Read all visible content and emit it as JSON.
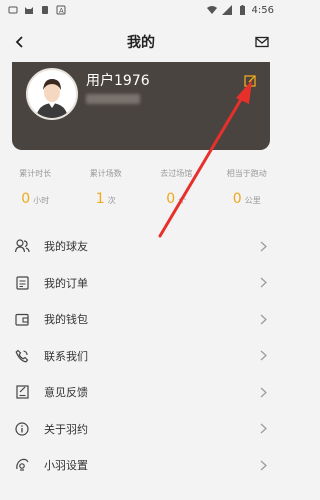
{
  "status_bar": {
    "time": "4:56"
  },
  "nav": {
    "title": "我的"
  },
  "profile": {
    "username": "用户1976"
  },
  "stats": [
    {
      "label": "累计时长",
      "value": "0",
      "unit": "小时"
    },
    {
      "label": "累计场数",
      "value": "1",
      "unit": "次"
    },
    {
      "label": "去过场馆",
      "value": "0",
      "unit": "个"
    },
    {
      "label": "相当于跑动",
      "value": "0",
      "unit": "公里"
    }
  ],
  "menu": [
    {
      "label": "我的球友",
      "icon": "friends-icon"
    },
    {
      "label": "我的订单",
      "icon": "order-icon"
    },
    {
      "label": "我的钱包",
      "icon": "wallet-icon"
    },
    {
      "label": "联系我们",
      "icon": "phone-icon"
    },
    {
      "label": "意见反馈",
      "icon": "feedback-icon"
    },
    {
      "label": "关于羽约",
      "icon": "info-icon"
    },
    {
      "label": "小羽设置",
      "icon": "settings-icon"
    }
  ],
  "colors": {
    "accent": "#f0a81c",
    "card": "#4a4440",
    "annotation": "#e8302a"
  }
}
